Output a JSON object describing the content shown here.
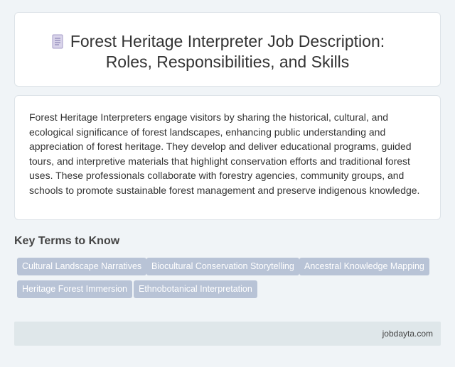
{
  "header": {
    "title_line1": "Forest Heritage Interpreter Job Description:",
    "title_line2": "Roles, Responsibilities, and Skills",
    "icon": "document-icon"
  },
  "intro": {
    "text": "Forest Heritage Interpreters engage visitors by sharing the historical, cultural, and ecological significance of forest landscapes, enhancing public understanding and appreciation of forest heritage. They develop and deliver educational programs, guided tours, and interpretive materials that highlight conservation efforts and traditional forest uses. These professionals collaborate with forestry agencies, community groups, and schools to promote sustainable forest management and preserve indigenous knowledge."
  },
  "key_terms": {
    "heading": "Key Terms to Know",
    "tags": [
      "Cultural Landscape Narratives",
      "Biocultural Conservation Storytelling",
      "Ancestral Knowledge Mapping",
      "Heritage Forest Immersion",
      "Ethnobotanical Interpretation"
    ]
  },
  "footer": {
    "site": "jobdayta.com"
  }
}
